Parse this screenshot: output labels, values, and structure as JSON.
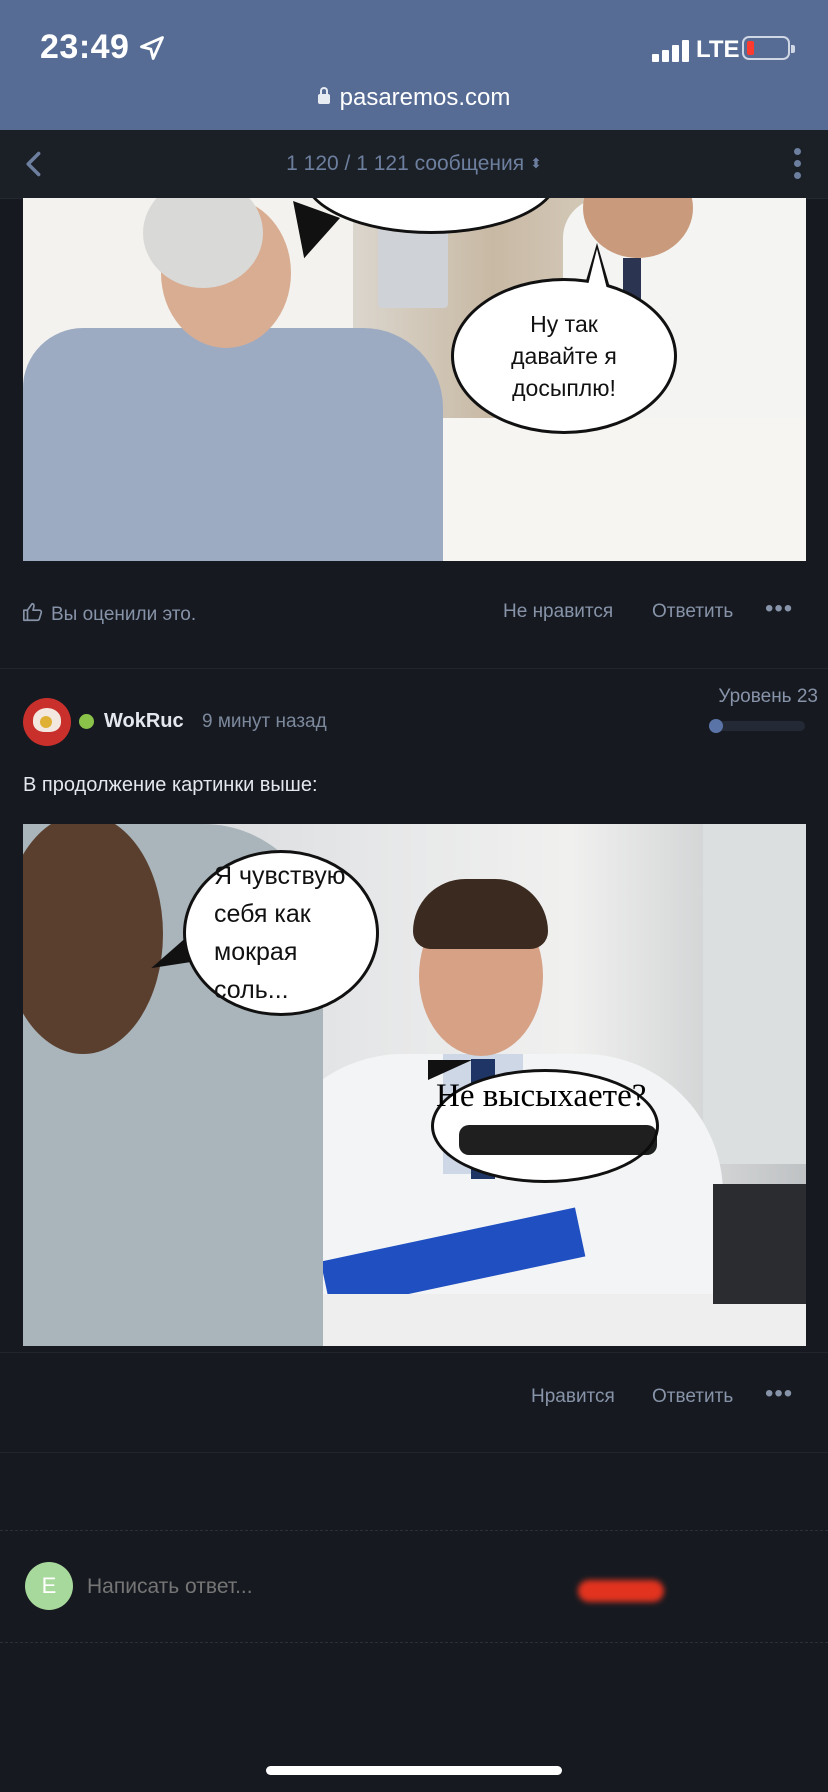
{
  "status_bar": {
    "time": "23:49",
    "network": "LTE",
    "url": "pasaremos.com"
  },
  "topic_nav": {
    "counter": "1 120 / 1 121 сообщения"
  },
  "post1": {
    "image_speech_bubble": "Ну так давайте я досыплю!",
    "liked_text": "Вы оценили это.",
    "dislike_label": "Не нравится",
    "reply_label": "Ответить",
    "more_label": "•••"
  },
  "post2": {
    "username": "WokRuc",
    "time_ago": "9 минут назад",
    "level": "Уровень 23",
    "level_progress_fraction": 0.08,
    "text": "В продолжение картинки выше:",
    "image_bubble_patient": "Я чувствую себя как мокрая соль...",
    "image_bubble_doctor": "Не высыхаете?",
    "like_label": "Нравится",
    "reply_label": "Ответить",
    "more_label": "•••"
  },
  "reply_box": {
    "avatar_letter": "E",
    "placeholder": "Написать ответ..."
  },
  "colors": {
    "status_bar_bg": "#566c94",
    "page_bg": "#161a20",
    "online_dot": "#8bc34a",
    "accent": "#5b74a8"
  }
}
